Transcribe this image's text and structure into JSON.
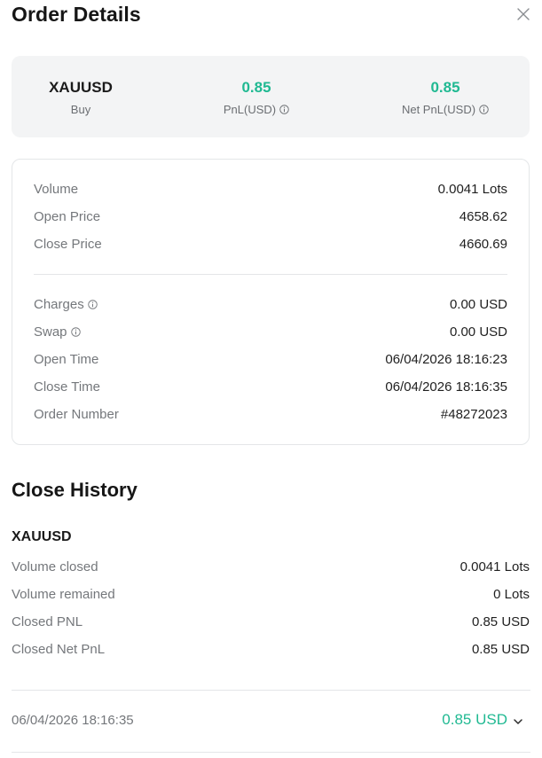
{
  "header": {
    "title": "Order Details"
  },
  "summary": {
    "symbol": "XAUUSD",
    "side": "Buy",
    "pnl_value": "0.85",
    "pnl_label": "PnL(USD)",
    "net_pnl_value": "0.85",
    "net_pnl_label": "Net PnL(USD)"
  },
  "details": {
    "group1": [
      {
        "label": "Volume",
        "value": "0.0041 Lots"
      },
      {
        "label": "Open Price",
        "value": "4658.62"
      },
      {
        "label": "Close Price",
        "value": "4660.69"
      }
    ],
    "group2": [
      {
        "label": "Charges",
        "value": "0.00 USD",
        "info_icon": true
      },
      {
        "label": "Swap",
        "value": "0.00 USD",
        "info_icon": true
      },
      {
        "label": "Open Time",
        "value": "06/04/2026 18:16:23"
      },
      {
        "label": "Close Time",
        "value": "06/04/2026 18:16:35"
      },
      {
        "label": "Order Number",
        "value": "#48272023"
      }
    ]
  },
  "close_history": {
    "title": "Close History",
    "symbol": "XAUUSD",
    "rows": [
      {
        "label": "Volume closed",
        "value": "0.0041 Lots"
      },
      {
        "label": "Volume remained",
        "value": "0 Lots"
      },
      {
        "label": "Closed PNL",
        "value": "0.85 USD"
      },
      {
        "label": "Closed Net PnL",
        "value": "0.85 USD"
      }
    ],
    "records": [
      {
        "time": "06/04/2026 18:16:35",
        "amount": "0.85 USD"
      }
    ]
  },
  "colors": {
    "accent_green": "#20b992",
    "label_gray": "#74777b",
    "card_bg": "#f3f4f5",
    "border": "#e4e6e8"
  },
  "icons": {
    "close": "close-icon",
    "info": "info-icon",
    "expand": "chevron-down-icon"
  }
}
